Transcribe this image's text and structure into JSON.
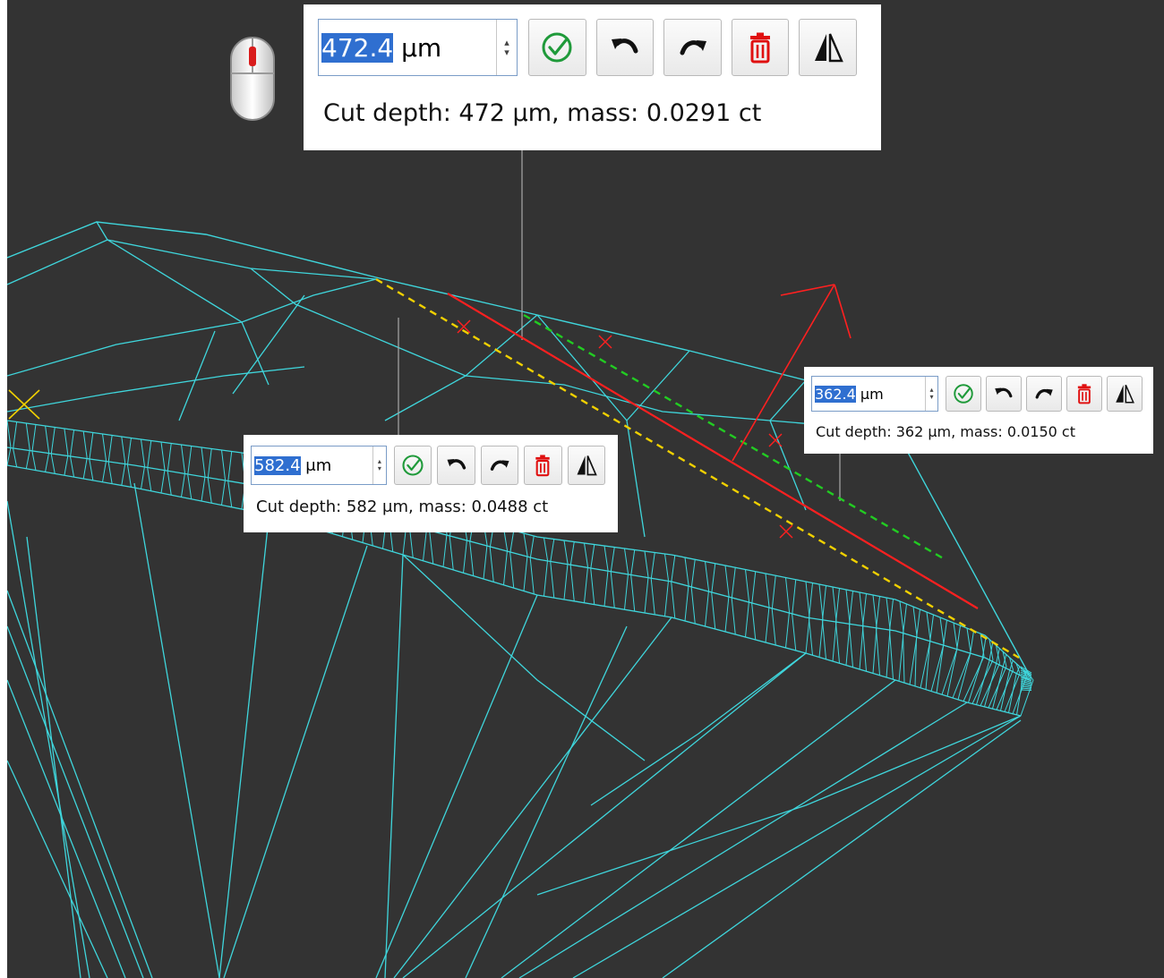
{
  "colors": {
    "background": "#333333",
    "wireframe": "#3fd6dc",
    "cut_line": "#ff2020",
    "guide_yellow": "#f0d000",
    "guide_green": "#22cc22",
    "confirm_green": "#1f9a3a",
    "delete_red": "#e01010",
    "selection_blue": "#2f6fd0"
  },
  "mouse_hint": {
    "icon": "mouse-icon"
  },
  "popups": {
    "main": {
      "value": "472.4",
      "unit": "μm",
      "caption": "Cut depth: 472 μm, mass: 0.0291 ct"
    },
    "left": {
      "value": "582.4",
      "unit": "μm",
      "caption": "Cut depth: 582 μm, mass: 0.0488 ct"
    },
    "right": {
      "value": "362.4",
      "unit": "μm",
      "caption": "Cut depth: 362 μm, mass: 0.0150 ct"
    }
  },
  "toolbar_icons": [
    "check-circle-icon",
    "undo-icon",
    "redo-icon",
    "trash-icon",
    "mirror-icon"
  ]
}
